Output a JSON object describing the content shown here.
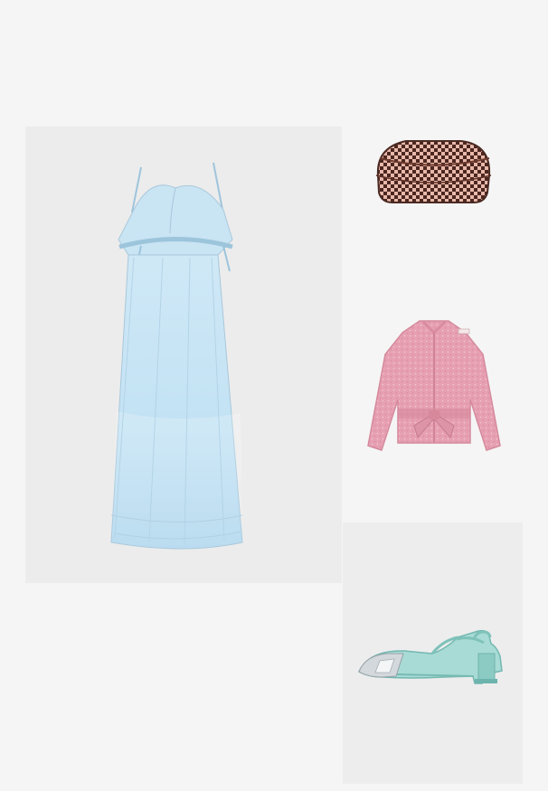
{
  "products": [
    {
      "name": "dress",
      "color": "#bfe0f2"
    },
    {
      "name": "clutch",
      "color": "#5a2f24"
    },
    {
      "name": "cardigan",
      "color": "#e8a3b1"
    },
    {
      "name": "shoe",
      "color": "#a8dbd5"
    }
  ],
  "colors": {
    "page_bg": "#f5f5f5",
    "panel_bg": "#ececec",
    "dress": "#bfe0f2",
    "clutch_dark": "#5a2f24",
    "clutch_light": "#e7b8a9",
    "cardigan": "#e8a3b1",
    "shoe": "#a8dbd5",
    "metal": "#cfd4d8"
  }
}
